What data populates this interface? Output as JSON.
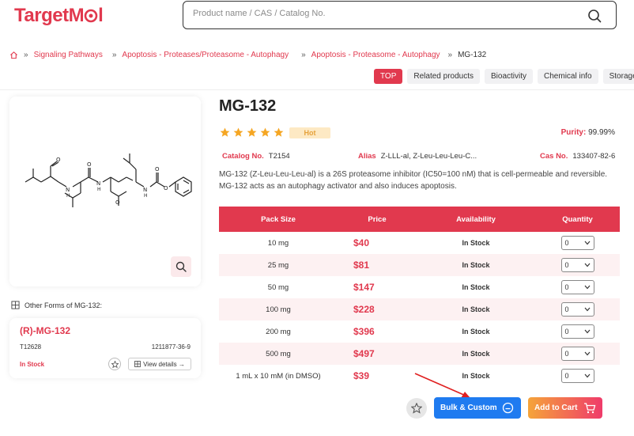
{
  "header": {
    "logo": {
      "part1": "Target",
      "part2": "M",
      "part3": "l"
    },
    "search_placeholder": "Product name / CAS / Catalog No."
  },
  "breadcrumb": {
    "items": [
      "Signaling Pathways",
      "Apoptosis - Proteases/Proteasome - Autophagy",
      "Apoptosis - Proteasome - Autophagy"
    ],
    "current": "MG-132"
  },
  "tabs": [
    "TOP",
    "Related products",
    "Bioactivity",
    "Chemical info",
    "Storage&S"
  ],
  "product": {
    "title": "MG-132",
    "hot_label": "Hot",
    "rating": 5,
    "purity_label": "Purity:",
    "purity_value": "99.99%",
    "catalog_label": "Catalog No.",
    "catalog_value": "T2154",
    "alias_label": "Alias",
    "alias_value": "Z-LLL-al, Z-Leu-Leu-Leu-C...",
    "cas_label": "Cas No.",
    "cas_value": "133407-82-6",
    "description": "MG-132 (Z-Leu-Leu-Leu-al) is a 26S proteasome inhibitor (IC50=100 nM) that is cell-permeable and reversible. MG-132 acts as an autophagy activator and also induces apoptosis."
  },
  "other_forms": {
    "label": "Other Forms of MG-132:",
    "name": "(R)-MG-132",
    "catalog": "T12628",
    "cas": "1211877-36-9",
    "stock": "In Stock",
    "view_label": "View details →"
  },
  "table": {
    "headers": [
      "Pack Size",
      "Price",
      "Availability",
      "Quantity"
    ],
    "rows": [
      {
        "size": "10 mg",
        "price": "$40",
        "availability": "In Stock",
        "qty": "0"
      },
      {
        "size": "25 mg",
        "price": "$81",
        "availability": "In Stock",
        "qty": "0"
      },
      {
        "size": "50 mg",
        "price": "$147",
        "availability": "In Stock",
        "qty": "0"
      },
      {
        "size": "100 mg",
        "price": "$228",
        "availability": "In Stock",
        "qty": "0"
      },
      {
        "size": "200 mg",
        "price": "$396",
        "availability": "In Stock",
        "qty": "0"
      },
      {
        "size": "500 mg",
        "price": "$497",
        "availability": "In Stock",
        "qty": "0"
      },
      {
        "size": "1 mL x 10 mM (in DMSO)",
        "price": "$39",
        "availability": "In Stock",
        "qty": "0"
      }
    ]
  },
  "actions": {
    "bulk_label": "Bulk & Custom",
    "cart_label": "Add to Cart"
  },
  "colors": {
    "brand": "#e1394e",
    "bulk": "#1f7bf0",
    "star": "#f5a623"
  }
}
